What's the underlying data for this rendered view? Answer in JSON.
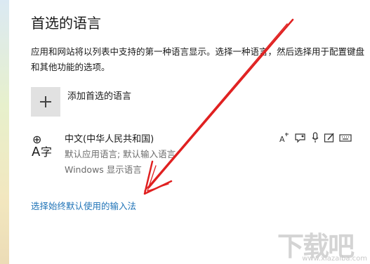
{
  "page": {
    "title": "首选的语言",
    "description": "应用和网站将以列表中支持的第一种语言显示。选择一种语言，然后选择用于配置键盘和其他功能的选项。"
  },
  "add_language": {
    "label": "添加首选的语言",
    "icon": "plus-icon"
  },
  "language": {
    "name": "中文(中华人民共和国)",
    "line1": "默认应用语言; 默认输入语言",
    "line2": "Windows 显示语言",
    "icon": "language-chinese-icon",
    "features": [
      "text-to-speech-icon",
      "speech-recognition-icon",
      "microphone-icon",
      "handwriting-icon",
      "keyboard-icon"
    ]
  },
  "link": {
    "label": "选择始终默认使用的输入法"
  },
  "annotation": {
    "arrow_color": "#e02020"
  },
  "watermark": {
    "text": "下载吧",
    "sub": "www.xiazaiba.com"
  },
  "colors": {
    "accent": "#1f73b7",
    "add_box": "#e1e1e1"
  }
}
